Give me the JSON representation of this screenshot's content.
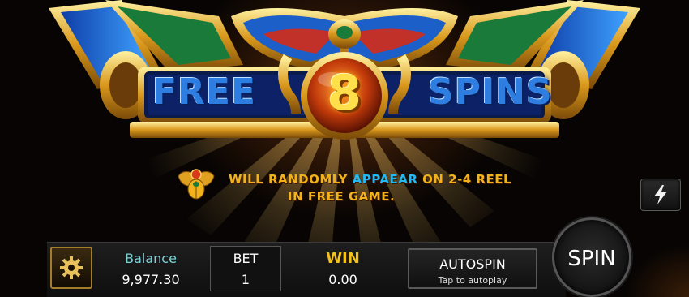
{
  "banner": {
    "word_left": "FREE",
    "count": "8",
    "word_right": "SPINS"
  },
  "info": {
    "line1_part1": "WILL RANDOMLY ",
    "line1_highlight": "APPAEAR",
    "line1_part2": " ON 2-4 REEL",
    "line2": "IN FREE GAME."
  },
  "controls": {
    "balance_label": "Balance",
    "balance_value": "9,977.30",
    "bet_label": "BET",
    "bet_value": "1",
    "win_label": "WIN",
    "win_value": "0.00",
    "autospin_label": "AUTOSPIN",
    "autospin_hint": "Tap to autoplay",
    "spin_label": "SPIN"
  },
  "icons": {
    "settings": "gear-icon",
    "turbo": "lightning-icon",
    "scarab": "scarab-icon"
  },
  "colors": {
    "title_blue": "#2e7de0",
    "info_gold": "#f2b21b",
    "info_highlight": "#23b9f5",
    "win_gold": "#f5c21a",
    "balance_label": "#7fd3d6"
  }
}
